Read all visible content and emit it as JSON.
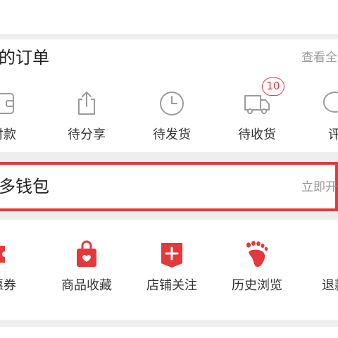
{
  "colors": {
    "accent": "#e4393c",
    "icon_gray": "#9b9b9b",
    "background": "#eeeeee"
  },
  "orders": {
    "title": "的订单",
    "view_all": "查看全",
    "items": [
      {
        "label": "付款",
        "icon": "wallet-icon"
      },
      {
        "label": "待分享",
        "icon": "share-icon"
      },
      {
        "label": "待发货",
        "icon": "clock-icon"
      },
      {
        "label": "待收货",
        "icon": "truck-icon",
        "badge": "10"
      },
      {
        "label": "评",
        "icon": "comment-icon"
      }
    ]
  },
  "wallet": {
    "title": "多钱包",
    "action": "立即开"
  },
  "services": {
    "items": [
      {
        "label": "惠券",
        "icon": "coupon-icon"
      },
      {
        "label": "商品收藏",
        "icon": "favorites-bag-icon"
      },
      {
        "label": "店铺关注",
        "icon": "store-follow-icon"
      },
      {
        "label": "历史浏览",
        "icon": "footprint-icon"
      },
      {
        "label": "退款",
        "icon": "refund-icon"
      }
    ]
  }
}
